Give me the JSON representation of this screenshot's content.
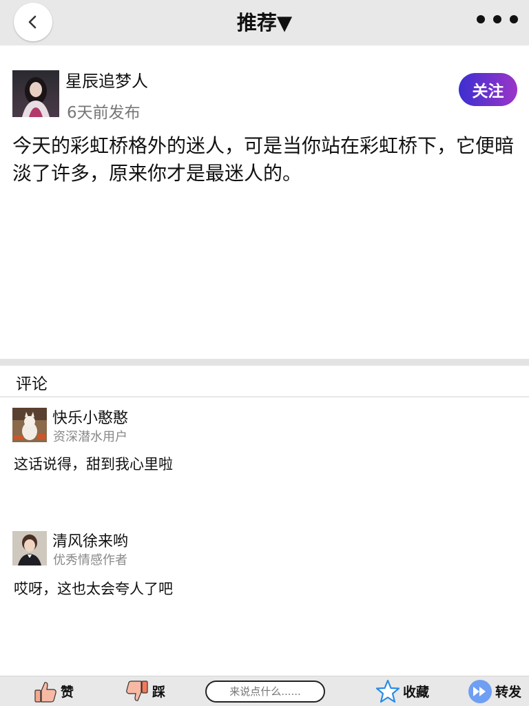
{
  "header": {
    "title": "推荐▼",
    "back_icon": "chevron-left-icon",
    "more_icon": "more-dots-icon"
  },
  "post": {
    "author_name": "星辰追梦人",
    "time": "6天前发布",
    "follow_label": "关注",
    "text": "今天的彩虹桥格外的迷人，可是当你站在彩虹桥下，它便暗淡了许多，原来你才是最迷人的。"
  },
  "comments": {
    "title": "评论",
    "items": [
      {
        "name": "快乐小憨憨",
        "role": "资深潜水用户",
        "text": "这话说得，甜到我心里啦"
      },
      {
        "name": "清风徐来哟",
        "role": "优秀情感作者",
        "text": "哎呀，这也太会夸人了吧"
      }
    ]
  },
  "bottom_bar": {
    "like_label": "赞",
    "dislike_label": "踩",
    "input_placeholder": "来说点什么......",
    "collect_label": "收藏",
    "share_label": "转发"
  },
  "colors": {
    "follow_gradient_start": "#3c2fd0",
    "follow_gradient_end": "#9b35c8",
    "bar_bg": "#e8e8e8"
  }
}
